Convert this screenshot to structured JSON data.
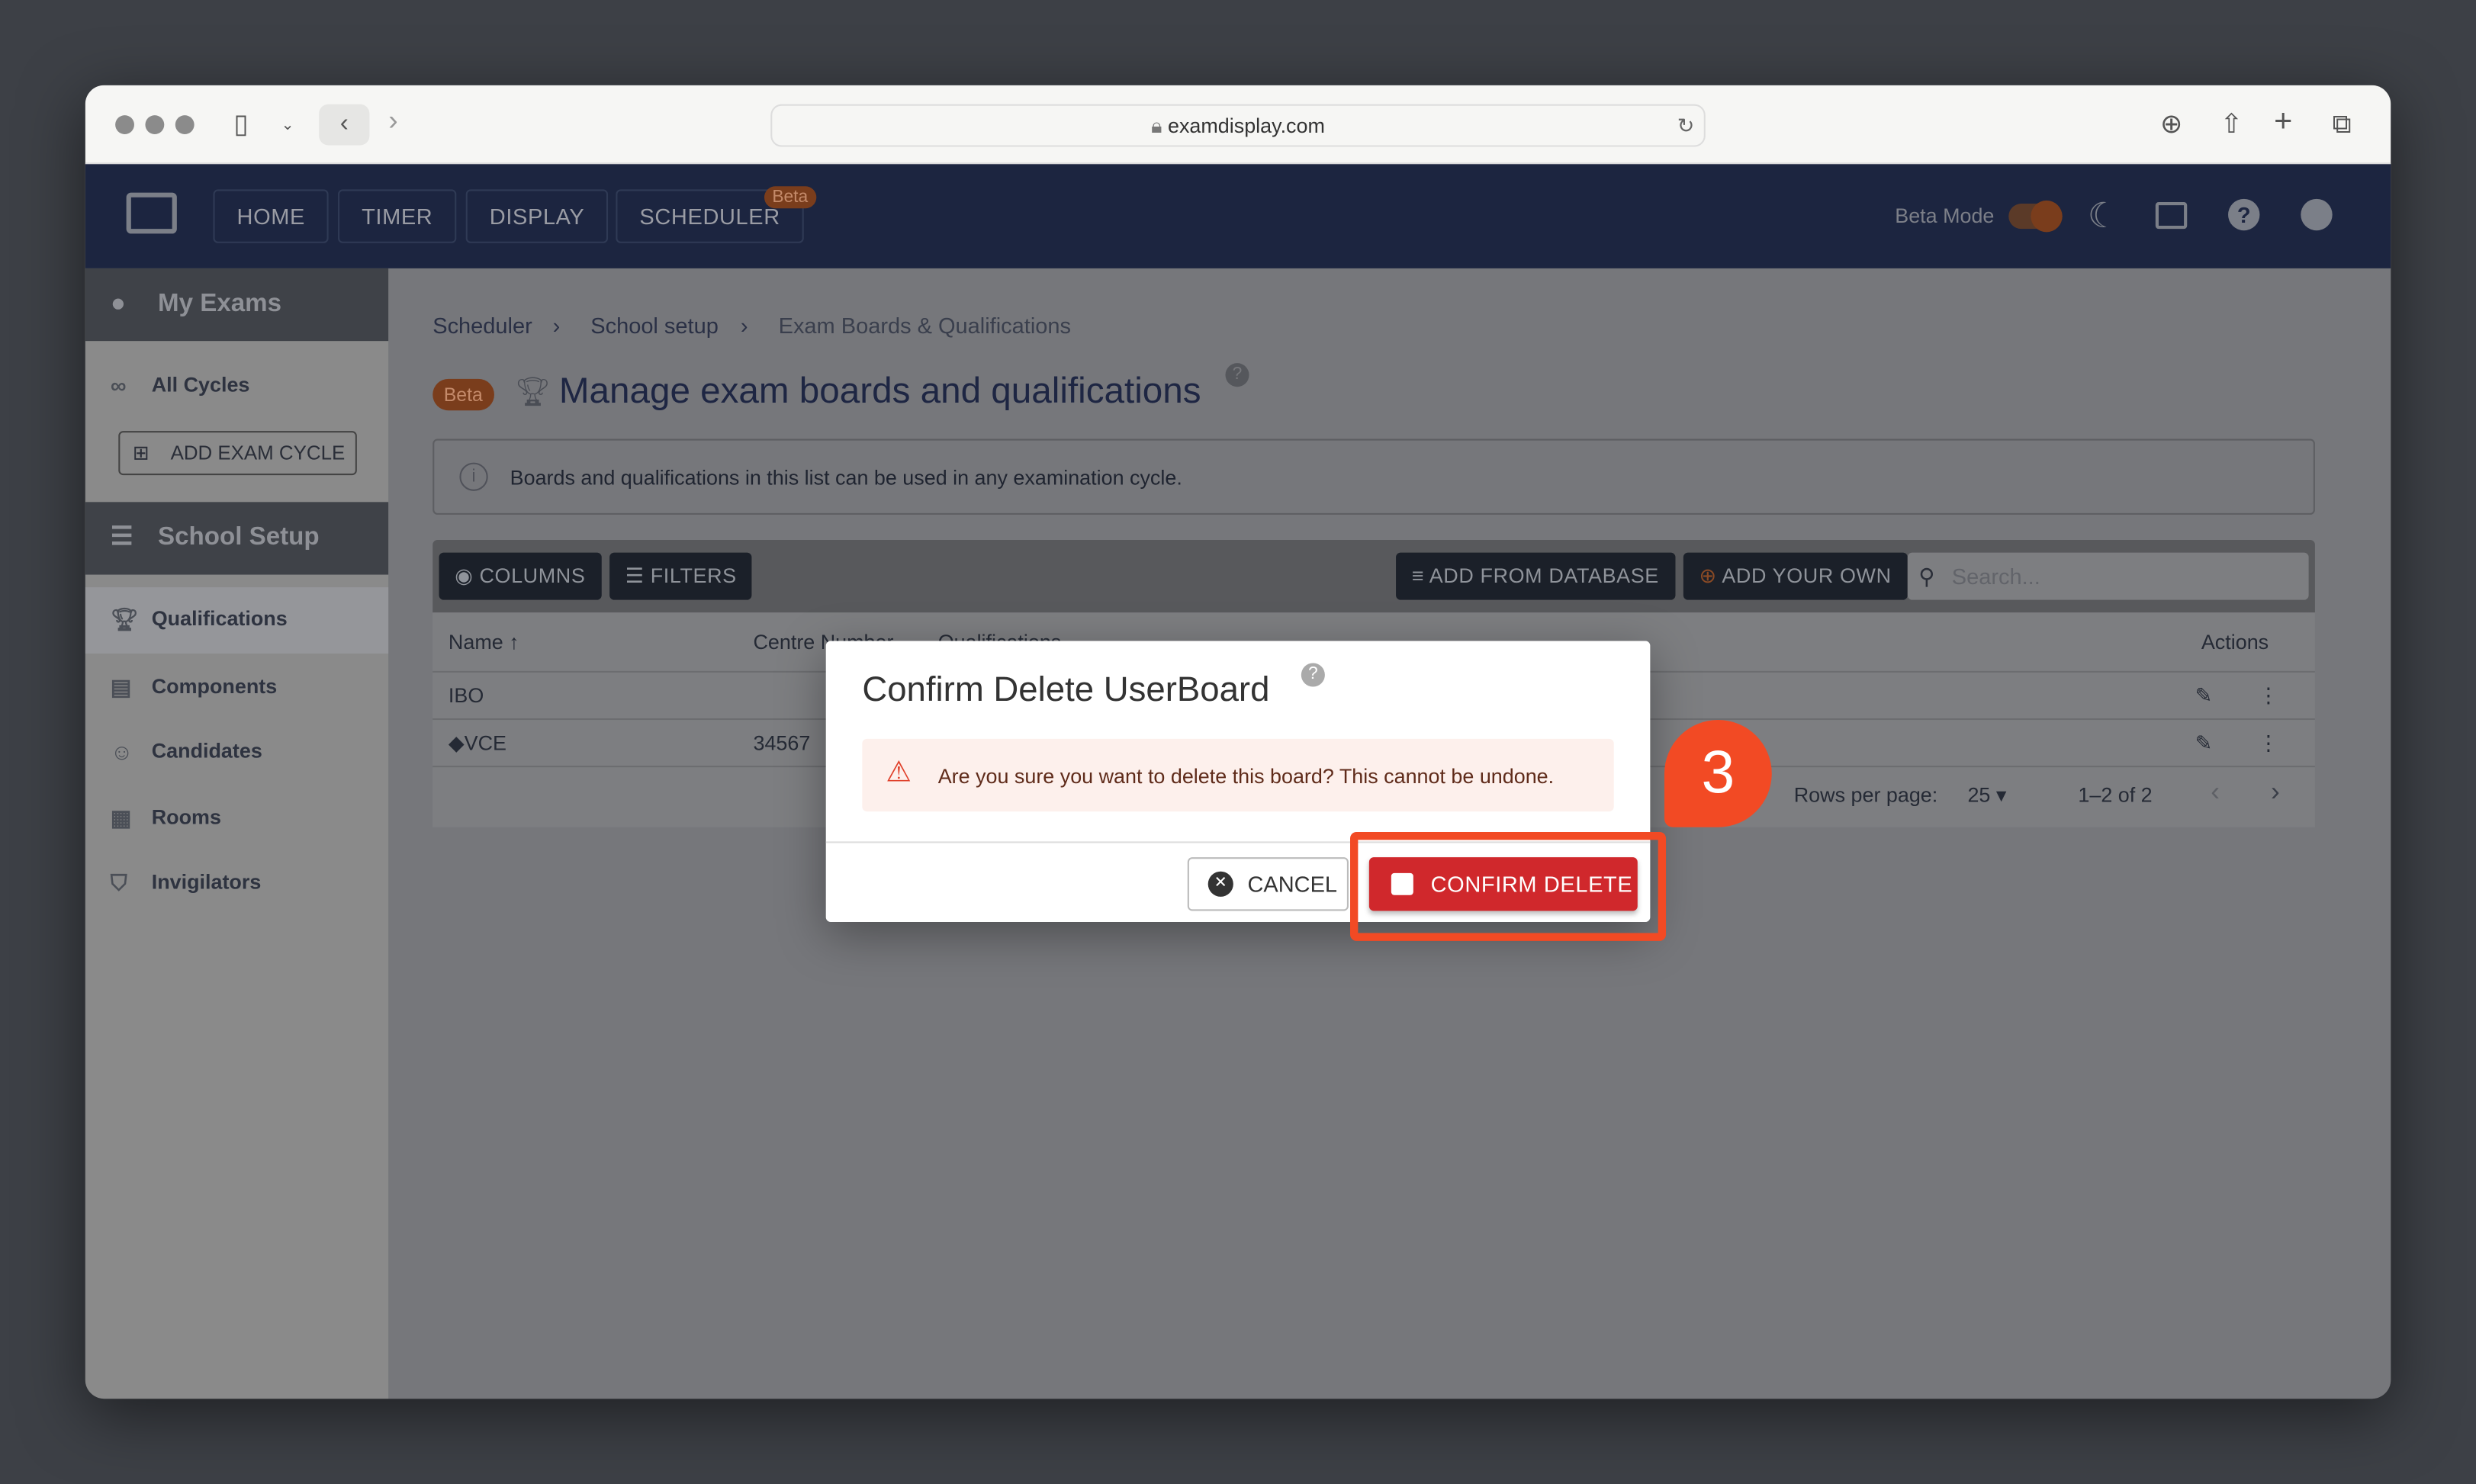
{
  "browser": {
    "url": "examdisplay.com"
  },
  "nav": {
    "items": [
      "HOME",
      "TIMER",
      "DISPLAY",
      "SCHEDULER"
    ],
    "scheduler_badge": "Beta",
    "beta_mode_label": "Beta Mode",
    "beta_mode_on": true
  },
  "sidebar": {
    "my_exams": "My Exams",
    "all_cycles": "All Cycles",
    "add_exam_cycle": "ADD EXAM CYCLE",
    "school_setup": "School Setup",
    "items": [
      "Qualifications",
      "Components",
      "Candidates",
      "Rooms",
      "Invigilators"
    ],
    "selected": "Qualifications"
  },
  "breadcrumb": [
    "Scheduler",
    "School setup",
    "Exam Boards & Qualifications"
  ],
  "page": {
    "badge": "Beta",
    "title": "Manage exam boards and qualifications",
    "info": "Boards and qualifications in this list can be used in any examination cycle."
  },
  "toolbar": {
    "columns": "COLUMNS",
    "filters": "FILTERS",
    "add_from_database": "ADD FROM DATABASE",
    "add_your_own": "ADD YOUR OWN",
    "search_placeholder": "Search..."
  },
  "table": {
    "headers": [
      "Name",
      "Centre Number",
      "Qualifications",
      "Actions"
    ],
    "rows": [
      {
        "name": "IBO",
        "centre": ""
      },
      {
        "name": "VCE",
        "centre": "34567"
      }
    ],
    "rows_per_page_label": "Rows per page:",
    "rows_per_page": "25",
    "range": "1–2 of 2"
  },
  "dialog": {
    "title": "Confirm Delete UserBoard",
    "warning": "Are you sure you want to delete this board? This cannot be undone.",
    "cancel": "CANCEL",
    "confirm": "CONFIRM DELETE"
  },
  "annotation": {
    "step": "3",
    "color": "#f24a24"
  },
  "colors": {
    "nav": "#1c2540",
    "confirm": "#d0282c",
    "beta": "#7a3d1c"
  }
}
